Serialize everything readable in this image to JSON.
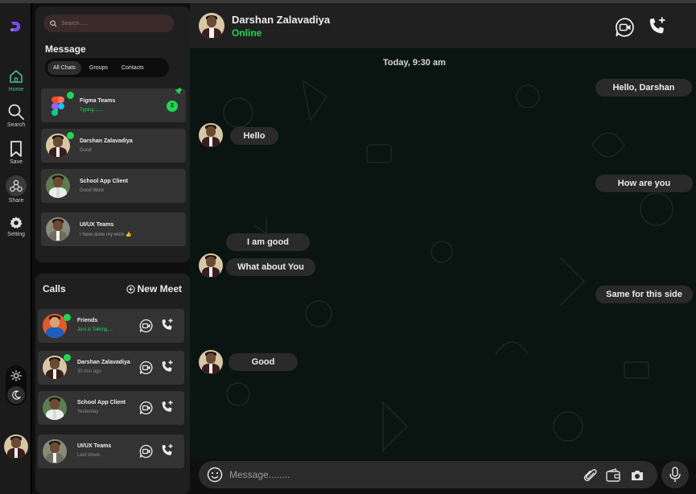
{
  "rail": {
    "items": [
      {
        "label": "Home"
      },
      {
        "label": "Search"
      },
      {
        "label": "Save"
      },
      {
        "label": "Share"
      },
      {
        "label": "Setting"
      }
    ]
  },
  "chats": {
    "search_placeholder": "Search......",
    "title": "Message",
    "tabs": [
      "All Chats",
      "Groups",
      "Contacts"
    ],
    "items": [
      {
        "name": "Figma Teams",
        "sub": "Typing.......",
        "badge": "2"
      },
      {
        "name": "Darshan Zalavadiya",
        "sub": "Good"
      },
      {
        "name": "School App Client",
        "sub": "Good Work"
      },
      {
        "name": "UI/UX Teams",
        "sub": "I have done my work 👍"
      }
    ]
  },
  "calls": {
    "title": "Calls",
    "new_meet": "New Meet",
    "items": [
      {
        "name": "Friends",
        "sub": "Joni is Talking...."
      },
      {
        "name": "Darshan Zalavadiya",
        "sub": "30 min ago"
      },
      {
        "name": "School App Client",
        "sub": "Yesterday"
      },
      {
        "name": "UI/UX Teams",
        "sub": "Last Week"
      }
    ]
  },
  "header": {
    "name": "Darshan Zalavadiya",
    "status": "Online"
  },
  "messages": {
    "date": "Today, 9:30 am",
    "list": [
      {
        "text": "Hello, Darshan",
        "side": "out"
      },
      {
        "text": "Hello",
        "side": "in"
      },
      {
        "text": "How are you",
        "side": "out"
      },
      {
        "text": "I am good",
        "side": "in"
      },
      {
        "text": "What about You",
        "side": "in"
      },
      {
        "text": "Same for this side",
        "side": "out"
      },
      {
        "text": "Good",
        "side": "in"
      }
    ]
  },
  "composer": {
    "placeholder": "Message........"
  },
  "colors": {
    "accent_green": "#1fd655",
    "home_active": "#43c08f",
    "panel": "#1f1f1f",
    "bubble": "#2a2a2a",
    "chat_bg": "#0a1512"
  },
  "icons": [
    "logo-icon",
    "home-icon",
    "search-icon",
    "bookmark-icon",
    "share-icon",
    "gear-icon",
    "sun-icon",
    "moon-icon",
    "pin-icon",
    "plus-circle-icon",
    "video-call-icon",
    "phone-add-icon",
    "emoji-icon",
    "paperclip-icon",
    "wallet-icon",
    "camera-icon",
    "mic-icon"
  ]
}
